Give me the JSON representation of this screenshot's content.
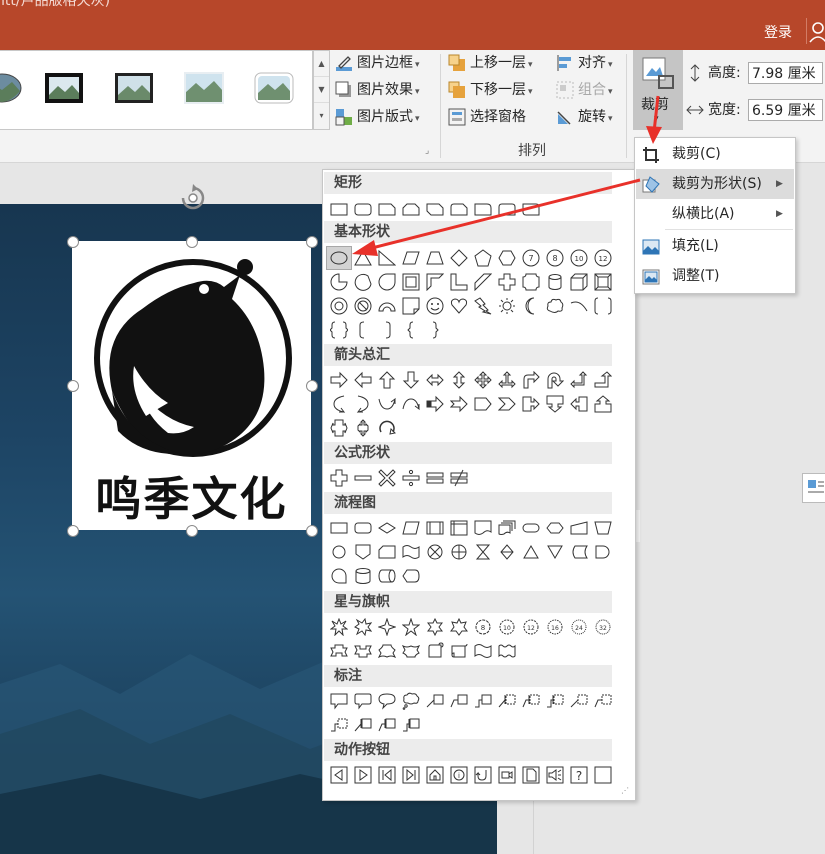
{
  "titlebar": {
    "title_fragment": "ntt/卢品版格天灰)",
    "login": "登录"
  },
  "ribbon": {
    "picture_styles": {
      "gallery_count": 6
    },
    "border": "图片边框",
    "effects": "图片效果",
    "layout": "图片版式",
    "bring_forward": "上移一层",
    "send_backward": "下移一层",
    "selection_pane": "选择窗格",
    "align": "对齐",
    "group": "组合",
    "rotate": "旋转",
    "arrange_label": "排列",
    "crop": "裁剪",
    "height_label": "高度:",
    "height_value": "7.98 厘米",
    "width_label": "宽度:",
    "width_value": "6.59 厘米"
  },
  "crop_menu": {
    "items": [
      {
        "label": "裁剪(C)",
        "has_submenu": false
      },
      {
        "label": "裁剪为形状(S)",
        "has_submenu": true
      },
      {
        "label": "纵横比(A)",
        "has_submenu": true
      },
      {
        "label": "填充(L)",
        "has_submenu": false
      },
      {
        "label": "调整(T)",
        "has_submenu": false
      }
    ]
  },
  "shapes_menu": {
    "categories": [
      "矩形",
      "基本形状",
      "箭头总汇",
      "公式形状",
      "流程图",
      "星与旗帜",
      "标注",
      "动作按钮"
    ],
    "selected_shape": "oval"
  },
  "slide": {
    "logo_text": "鸣季文化"
  },
  "colors": {
    "titlebar": "#b7472a",
    "annotation_arrow": "#e8312a",
    "ribbon": "#f3f3f3"
  }
}
